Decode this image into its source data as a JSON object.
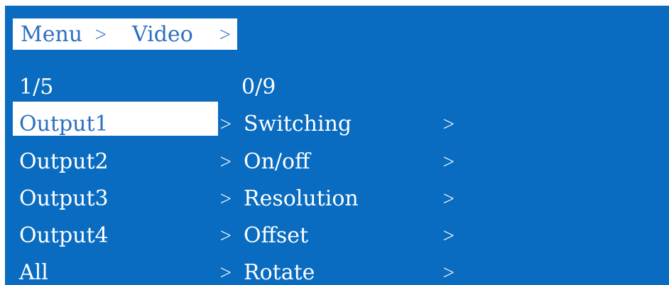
{
  "breadcrumb": {
    "items": [
      {
        "label": "Menu",
        "sep": ">"
      },
      {
        "label": "Video",
        "sep": ">"
      }
    ]
  },
  "left_list": {
    "counter": "1/5",
    "selected_index": 0,
    "chevron": ">",
    "items": [
      {
        "label": "Output1"
      },
      {
        "label": "Output2"
      },
      {
        "label": "Output3"
      },
      {
        "label": "Output4"
      },
      {
        "label": "All"
      }
    ]
  },
  "right_list": {
    "counter": "0/9",
    "chevron": ">",
    "items": [
      {
        "label": "Switching"
      },
      {
        "label": "On/off"
      },
      {
        "label": "Resolution"
      },
      {
        "label": "Offset"
      },
      {
        "label": "Rotate"
      }
    ]
  },
  "colors": {
    "background": "#0a6cc0",
    "highlight_bg": "#ffffff",
    "highlight_text": "#2d6fc0",
    "text": "#ffffff"
  }
}
